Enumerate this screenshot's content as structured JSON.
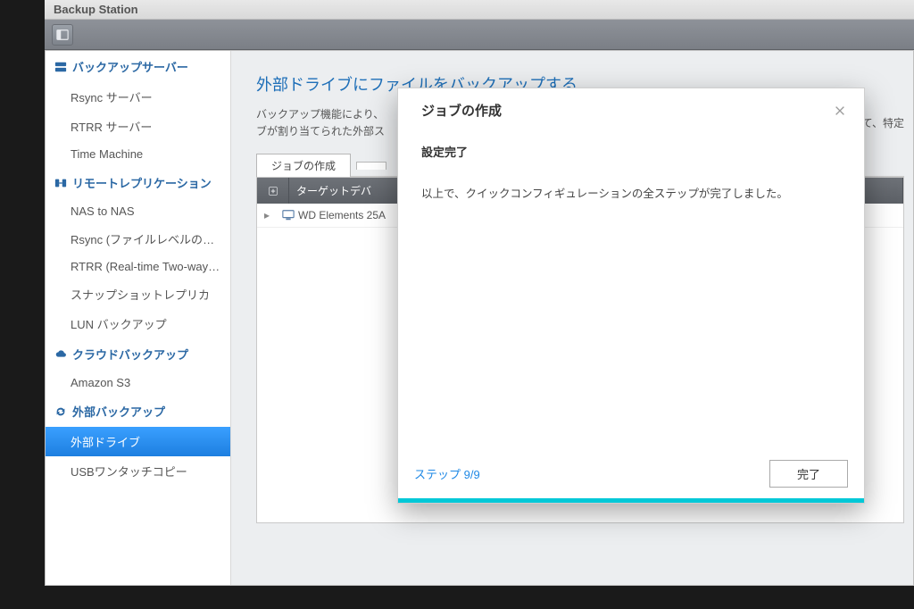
{
  "app": {
    "title": "Backup Station"
  },
  "sidebar": {
    "g1": {
      "label": "バックアップサーバー"
    },
    "g1_items": [
      "Rsync サーバー",
      "RTRR サーバー",
      "Time Machine"
    ],
    "g2": {
      "label": "リモートレプリケーション"
    },
    "g2_items": [
      "NAS to NAS",
      "Rsync (ファイルレベルのバック...",
      "RTRR (Real-time Two-way Folde...",
      "スナップショットレプリカ",
      "LUN バックアップ"
    ],
    "g3": {
      "label": "クラウドバックアップ"
    },
    "g3_items": [
      "Amazon S3"
    ],
    "g4": {
      "label": "外部バックアップ"
    },
    "g4_items": [
      "外部ドライブ",
      "USBワンタッチコピー"
    ]
  },
  "main": {
    "title": "外部ドライブにファイルをバックアップする",
    "desc_a": "バックアップ機能により、",
    "desc_b": "ブが割り当てられた外部ス",
    "desc_tail": "して、特定",
    "create_job": "ジョブの作成",
    "col_target": "ターゲットデバ",
    "row_device": "WD Elements 25A"
  },
  "modal": {
    "title": "ジョブの作成",
    "heading": "設定完了",
    "message": "以上で、クイックコンフィギュレーションの全ステップが完了しました。",
    "step": "ステップ 9/9",
    "finish": "完了"
  }
}
